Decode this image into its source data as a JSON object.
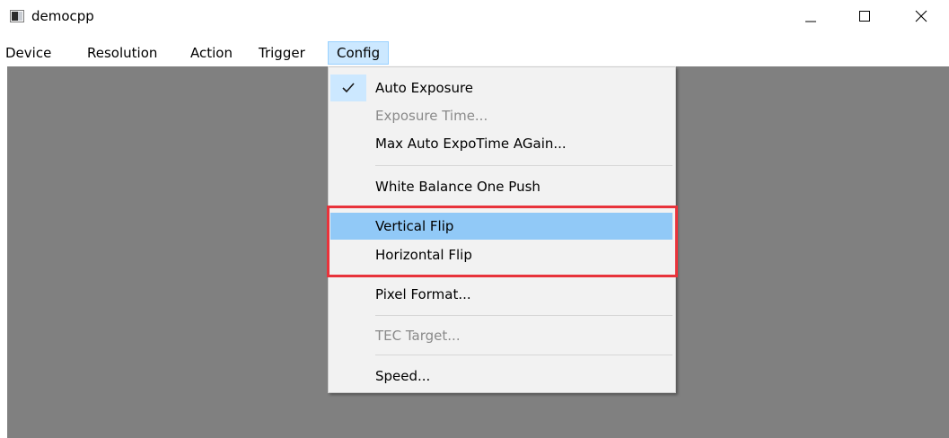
{
  "window": {
    "title": "democpp",
    "icons": {
      "app": "app-icon",
      "minimize": "minimize-icon",
      "maximize": "maximize-icon",
      "close": "close-icon"
    }
  },
  "menubar": {
    "items": [
      {
        "label": "Device"
      },
      {
        "label": "Resolution"
      },
      {
        "label": "Action"
      },
      {
        "label": "Trigger"
      },
      {
        "label": "Config",
        "active": true
      }
    ]
  },
  "config_menu": {
    "items": [
      {
        "label": "Auto Exposure",
        "checked": true,
        "enabled": true
      },
      {
        "label": "Exposure Time...",
        "enabled": false
      },
      {
        "label": "Max Auto ExpoTime AGain...",
        "enabled": true
      },
      {
        "label": "White Balance One Push",
        "enabled": true
      },
      {
        "label": "Vertical Flip",
        "enabled": true,
        "highlighted": true
      },
      {
        "label": "Horizontal Flip",
        "enabled": true
      },
      {
        "label": "Pixel Format...",
        "enabled": true
      },
      {
        "label": "TEC Target...",
        "enabled": false
      },
      {
        "label": "Speed...",
        "enabled": true
      }
    ]
  },
  "colors": {
    "viewport": "#808080",
    "menu_bg": "#f2f2f2",
    "hover": "#91c9f7",
    "annotation_box": "#e8333b",
    "disabled_text": "#8a8a8a"
  }
}
